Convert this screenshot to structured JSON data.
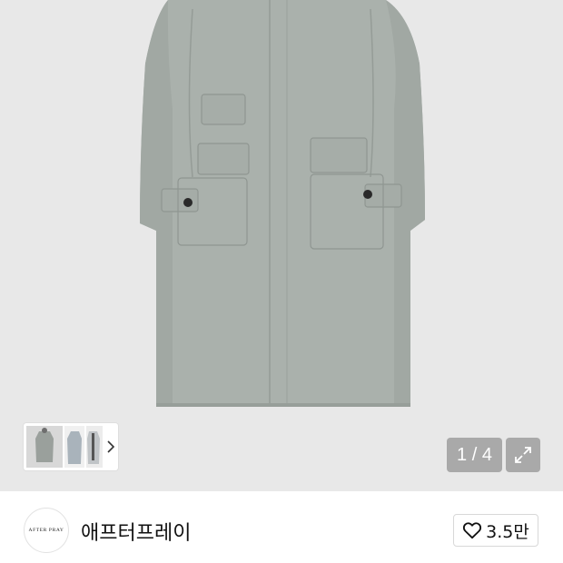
{
  "gallery": {
    "current_page": 1,
    "total_pages": 4,
    "counter_text": "1 / 4",
    "thumbnail_count": 3,
    "selected_thumbnail": 1,
    "colors": {
      "background": "#e8e8e8",
      "coat": "#a9b0ab",
      "counter_bg": "#a9a9a9"
    }
  },
  "brand": {
    "logo_text": "AFTER PRAY",
    "name": "애프터프레이"
  },
  "like": {
    "count": "3.5만",
    "icon": "heart-outline-icon"
  },
  "icons": {
    "thumbnail_next": "chevron-right-icon",
    "expand": "expand-arrows-icon"
  }
}
